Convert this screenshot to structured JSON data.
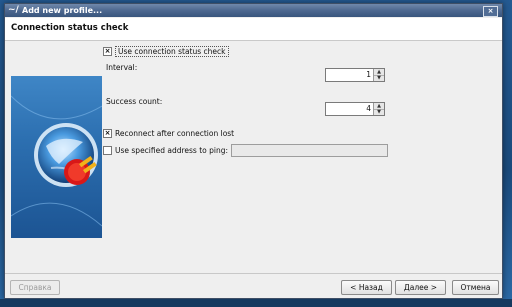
{
  "window": {
    "title": "Add new profile...",
    "icon": "connection-icon",
    "close_label": "×"
  },
  "page": {
    "heading": "Connection status check"
  },
  "form": {
    "use_check": {
      "label": "Use connection status check",
      "checked": true,
      "mark": "×"
    },
    "interval": {
      "label": "Interval:",
      "value": "1"
    },
    "success_count": {
      "label": "Success count:",
      "value": "4"
    },
    "reconnect": {
      "label": "Reconnect after connection lost",
      "checked": true,
      "mark": "×"
    },
    "ping_address": {
      "label": "Use specified address to ping:",
      "checked": false,
      "value": ""
    }
  },
  "buttons": {
    "help": "Справка",
    "back": "< Назад",
    "next": "Далее >",
    "cancel": "Отмена"
  },
  "icons": {
    "spin_up": "▲",
    "spin_down": "▼"
  },
  "colors": {
    "titlebar": "#4d6890",
    "side_panel": "#2c6fb0",
    "plug": "#e02020"
  }
}
